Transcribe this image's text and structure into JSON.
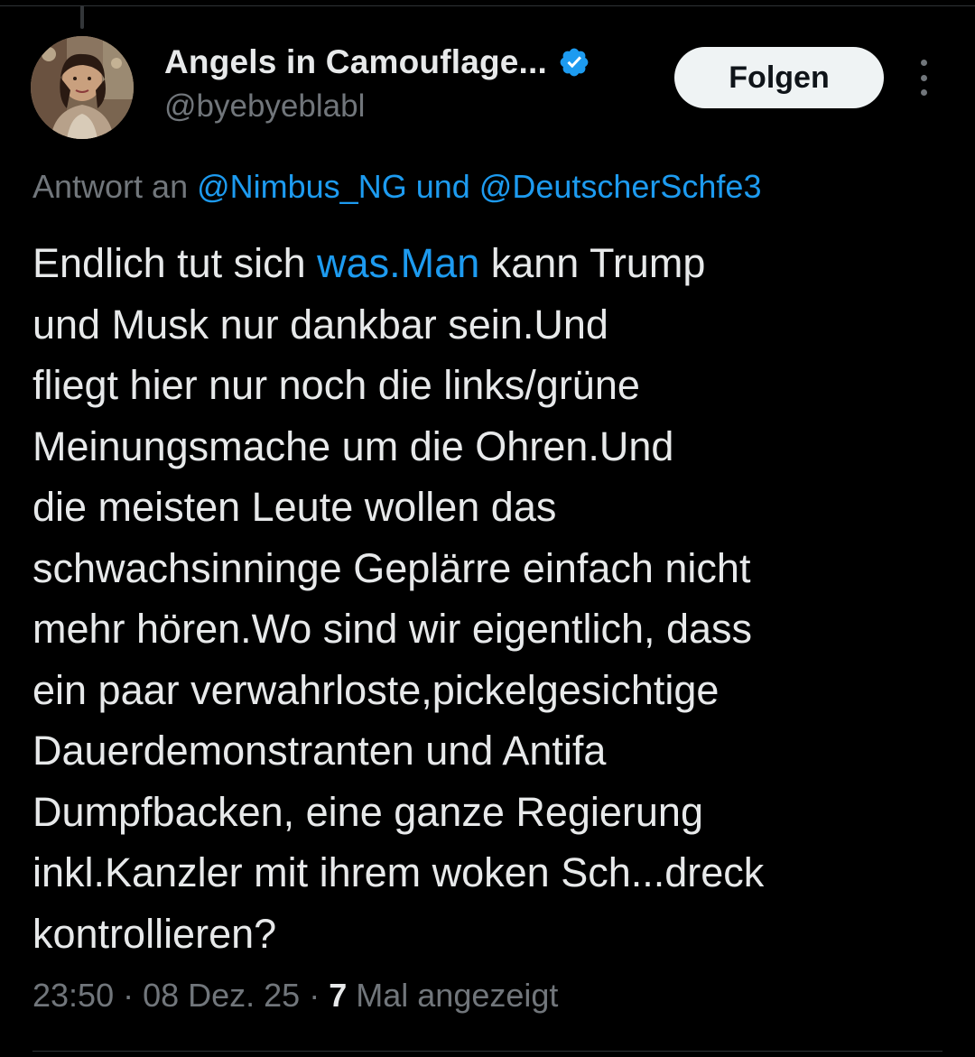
{
  "tweet": {
    "author": {
      "display_name": "Angels in Camouflage...",
      "handle": "@byebyeblabl",
      "verified_icon": "verified-badge-icon"
    },
    "follow_label": "Folgen",
    "more_icon": "more-vertical-icon",
    "reply_context": {
      "prefix": "Antwort an",
      "mentions": "@Nimbus_NG und @DeutscherSchfe3"
    },
    "text_lines": [
      {
        "before": "Endlich tut sich ",
        "link": "was.Man",
        "after": " kann Trump"
      },
      "und Musk nur dankbar sein.Und",
      "fliegt hier nur noch die links/grüne",
      "Meinungsmache um die Ohren.Und",
      "die meisten Leute wollen das",
      "schwachsinninge Geplärre einfach nicht",
      "mehr hören.Wo sind wir eigentlich, dass",
      "ein paar verwahrloste,pickelgesichtige",
      "Dauerdemonstranten und Antifa",
      "Dumpfbacken, eine ganze Regierung",
      "inkl.Kanzler mit ihrem woken Sch...dreck",
      "kontrollieren?"
    ],
    "meta": {
      "time": "23:50",
      "date": "08 Dez. 25",
      "views_count": "7",
      "views_label": "Mal angezeigt"
    }
  },
  "colors": {
    "background": "#000000",
    "text_primary": "#e7e9ea",
    "text_secondary": "#71767b",
    "accent_blue": "#1d9bf0",
    "button_bg": "#eff3f4"
  }
}
